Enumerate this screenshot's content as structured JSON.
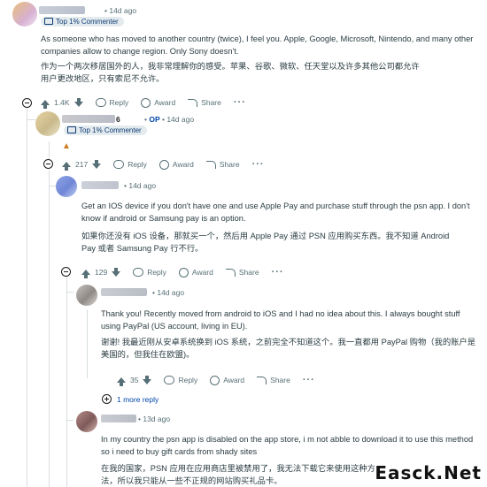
{
  "colors": {
    "op": "#0045ac",
    "meta": "#576f76",
    "flair_bg": "#e4ebee",
    "thread_line": "#d9dde0"
  },
  "comments": [
    {
      "author": "",
      "time": "14d ago",
      "flair": "Top 1% Commenter",
      "text_en": "As someone who has moved to another country (twice), I feel you. Apple, Google, Microsoft, Nintendo, and many other companies allow to change region. Only Sony doesn't.",
      "text_zh": "作为一个两次移居国外的人，我非常理解你的感受。苹果、谷歌、微软、任天堂以及许多其他公司都允许用户更改地区，只有索尼不允许。",
      "votes": "1.4K",
      "reply": "Reply",
      "award": "Award",
      "share": "Share"
    },
    {
      "author_suffix": "6",
      "op_badge": "OP",
      "time": "14d ago",
      "flair": "Top 1% Commenter",
      "votes": "217",
      "reply": "Reply",
      "award": "Award",
      "share": "Share"
    },
    {
      "time": "14d ago",
      "text_en": "Get an IOS device if you don't have one and use Apple Pay and purchase stuff through the psn app. I don't know if android or Samsung pay is an option.",
      "text_zh": "如果你还没有 iOS 设备，那就买一个，然后用 Apple Pay 通过 PSN 应用购买东西。我不知道 Android Pay 或者 Samsung Pay 行不行。",
      "votes": "129",
      "reply": "Reply",
      "award": "Award",
      "share": "Share"
    },
    {
      "time": "14d ago",
      "text_en": "Thank you! Recently moved from android to iOS and I had no idea about this. I always bought stuff using PayPal (US account, living in EU).",
      "text_zh": "谢谢! 我最近刚从安卓系统换到 iOS 系统，之前完全不知道这个。我一直都用 PayPal 购物（我的账户是美国的，但我住在欧盟)。",
      "votes": "35",
      "reply": "Reply",
      "award": "Award",
      "share": "Share",
      "more_replies": "1 more reply"
    },
    {
      "time": "13d ago",
      "text_en": "In my country the psn app is disabled on the app store, i m not abble to download it to use this method so i need to buy gift cards from shady sites",
      "text_zh": "在我的国家，PSN 应用在应用商店里被禁用了，我无法下载它来使用这种方法，所以我只能从一些不正规的网站购买礼品卡。"
    }
  ],
  "watermark": "Easck.Net"
}
